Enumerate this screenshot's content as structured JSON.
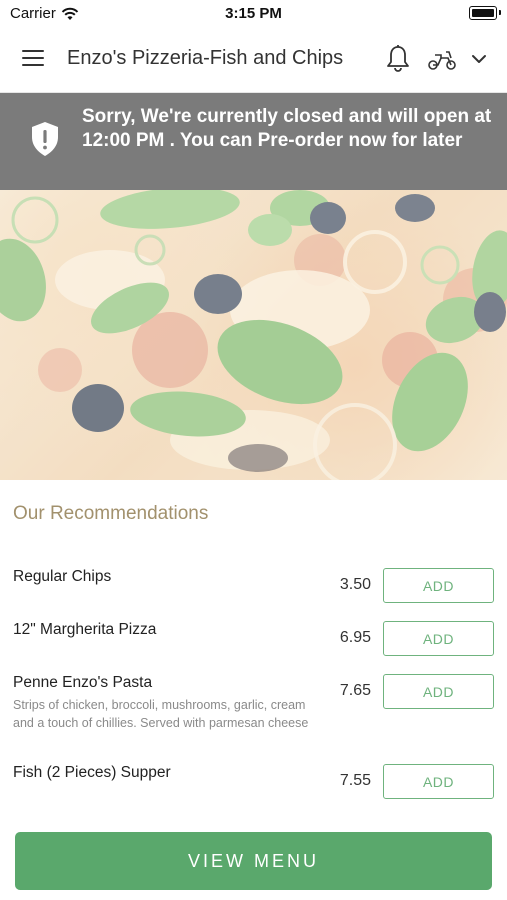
{
  "status_bar": {
    "carrier": "Carrier",
    "time": "3:15 PM",
    "wifi_icon": "wifi-icon",
    "battery_icon": "battery-icon"
  },
  "header": {
    "title": "Enzo's Pizzeria-Fish and Chips",
    "menu_icon": "hamburger-menu-icon",
    "bell_icon": "bell-icon",
    "delivery_icon": "scooter-icon",
    "dropdown_icon": "chevron-down-icon"
  },
  "banner": {
    "icon": "shield-alert-icon",
    "message": "Sorry, We're currently closed and will open at 12:00 PM . You can Pre-order now for later"
  },
  "hero": {
    "image": "pizza-photo"
  },
  "recommendations": {
    "title": "Our Recommendations",
    "items": [
      {
        "name": "Regular Chips",
        "price": "3.50",
        "description": "",
        "action": "ADD"
      },
      {
        "name": "12\" Margherita Pizza",
        "price": "6.95",
        "description": "",
        "action": "ADD"
      },
      {
        "name": "Penne Enzo's Pasta",
        "price": "7.65",
        "description": "Strips of chicken, broccoli, mushrooms, garlic, cream and a touch of chillies. Served with parmesan cheese",
        "action": "ADD"
      },
      {
        "name": "Fish (2 Pieces) Supper",
        "price": "7.55",
        "description": "",
        "action": "ADD"
      }
    ]
  },
  "footer": {
    "view_menu_label": "VIEW MENU"
  },
  "colors": {
    "accent_green": "#5aa86c",
    "banner_gray": "#7b7b7b",
    "section_title": "#a2916d"
  }
}
